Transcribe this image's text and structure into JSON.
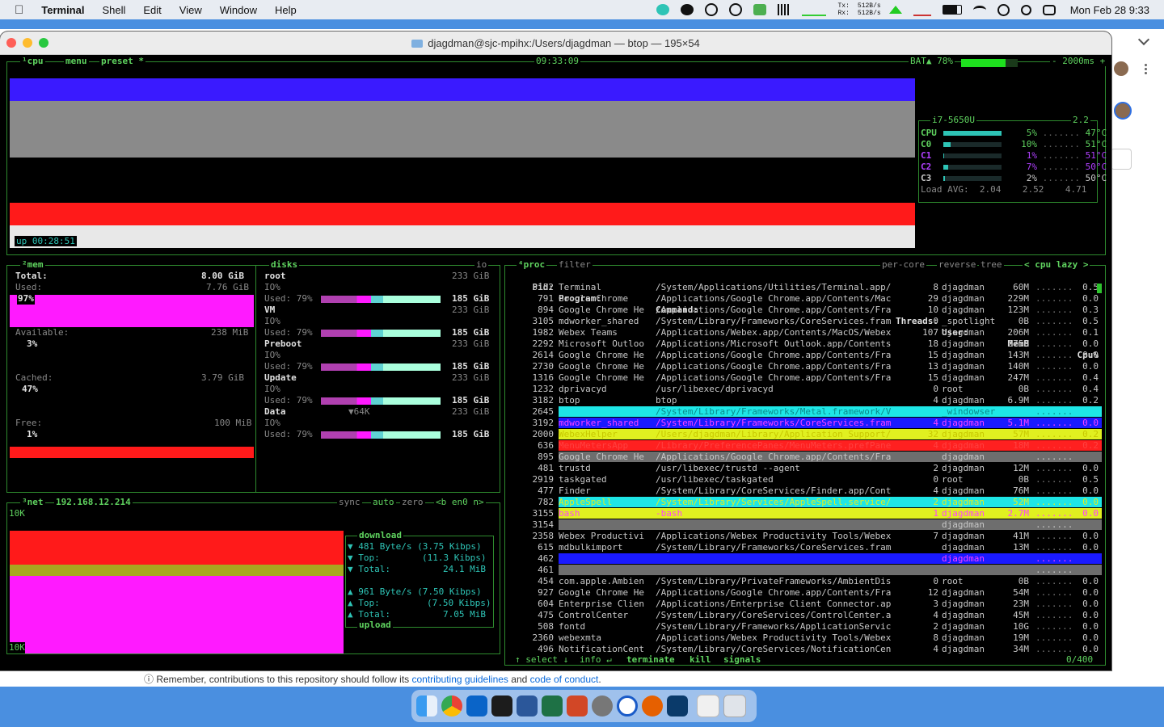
{
  "menubar": {
    "app": "Terminal",
    "items": [
      "Shell",
      "Edit",
      "View",
      "Window",
      "Help"
    ],
    "net_tx_label": "Tx:",
    "net_rx_label": "Rx:",
    "net_tx": "512B/s",
    "net_rx": "512B/s",
    "clock": "Mon Feb 28  9:33"
  },
  "window": {
    "title": "djagdman@sjc-mpihx:/Users/djagdman — btop — 195×54"
  },
  "cpu_box": {
    "tabs": [
      "¹cpu",
      "menu",
      "preset *"
    ],
    "time": "09:33:09",
    "battery": "BAT▲ 78%",
    "battery_level": 0.78,
    "interval": "- 2000ms +",
    "uptime_label": "up",
    "uptime": "00:28:51",
    "model": "i7-5650U",
    "freq": "2.2",
    "cores": [
      {
        "name": "CPU",
        "pct": "5%",
        "temp": "47°C",
        "color": "#5fd35f",
        "usage": 0.05
      },
      {
        "name": "C0",
        "pct": "10%",
        "temp": "51°C",
        "color": "#5fd35f",
        "usage": 0.1
      },
      {
        "name": "C1",
        "pct": "1%",
        "temp": "51°C",
        "color": "#b040ff",
        "usage": 0.01
      },
      {
        "name": "C2",
        "pct": "7%",
        "temp": "50°C",
        "color": "#b040ff",
        "usage": 0.07
      },
      {
        "name": "C3",
        "pct": "2%",
        "temp": "50°C",
        "color": "#c8c8c8",
        "usage": 0.02
      }
    ],
    "load_label": "Load AVG:",
    "load": [
      "2.04",
      "2.52",
      "4.71"
    ]
  },
  "mem_box": {
    "title": "²mem",
    "total_label": "Total:",
    "total": "8.00 GiB",
    "used_label": "Used:",
    "used": "7.76 GiB",
    "used_pct": "97%",
    "available_label": "Available:",
    "available": "238 MiB",
    "available_pct": "3%",
    "cached_label": "Cached:",
    "cached": "3.79 GiB",
    "cached_pct": "47%",
    "free_label": "Free:",
    "free": "100 MiB",
    "free_pct": "1%"
  },
  "disks_box": {
    "title": "disks",
    "io_label": "io",
    "disks": [
      {
        "name": "root",
        "size": "233 GiB",
        "io_label": "IO%",
        "used_label": "Used: 79%",
        "used": "185 GiB"
      },
      {
        "name": "VM",
        "size": "233 GiB",
        "io_label": "IO%",
        "used_label": "Used: 79%",
        "used": "185 GiB"
      },
      {
        "name": "Preboot",
        "size": "233 GiB",
        "io_label": "IO%",
        "used_label": "Used: 79%",
        "used": "185 GiB"
      },
      {
        "name": "Update",
        "size": "233 GiB",
        "io_label": "IO%",
        "used_label": "Used: 79%",
        "used": "185 GiB"
      },
      {
        "name": "Data",
        "size": "233 GiB",
        "extra": "▼64K",
        "io_label": "IO%",
        "used_label": "Used: 79%",
        "used": "185 GiB"
      }
    ]
  },
  "net_box": {
    "title": "³net",
    "ip": "192.168.12.214",
    "controls": [
      "sync",
      "auto",
      "zero",
      "<b en0 n>"
    ],
    "scale_top": "10K",
    "scale_bottom": "10K",
    "download_label": "download",
    "upload_label": "upload",
    "down_rate": "▼ 481 Byte/s (3.75 Kibps)",
    "down_top_label": "▼ Top:",
    "down_top": "(11.3 Kibps)",
    "down_total_label": "▼ Total:",
    "down_total": "24.1 MiB",
    "up_rate": "▲ 961 Byte/s (7.50 Kibps)",
    "up_top_label": "▲ Top:",
    "up_top": "(7.50 Kibps)",
    "up_total_label": "▲ Total:",
    "up_total": "7.05 MiB"
  },
  "proc_box": {
    "title": "⁴proc",
    "filter": "filter",
    "options": [
      "per-core",
      "reverse",
      "tree",
      "< cpu lazy >"
    ],
    "headers": {
      "pid": "Pid:",
      "program": "Program:",
      "command": "Command:",
      "threads": "Threads:",
      "user": "User:",
      "mem": "MemB",
      "cpu": "Cpu%"
    },
    "footer": [
      "↑ select ↓",
      "info ↵",
      "terminate",
      "kill",
      "signals"
    ],
    "count": "0/400",
    "rows": [
      {
        "pid": "3152",
        "program": "Terminal",
        "command": "/System/Applications/Utilities/Terminal.app/",
        "threads": "8",
        "user": "djagdman",
        "mem": "60M",
        "cpu": "0.5"
      },
      {
        "pid": "791",
        "program": "Google Chrome",
        "command": "/Applications/Google Chrome.app/Contents/Mac",
        "threads": "29",
        "user": "djagdman",
        "mem": "229M",
        "cpu": "0.0"
      },
      {
        "pid": "894",
        "program": "Google Chrome He",
        "command": "/Applications/Google Chrome.app/Contents/Fra",
        "threads": "10",
        "user": "djagdman",
        "mem": "123M",
        "cpu": "0.3"
      },
      {
        "pid": "3105",
        "program": "mdworker_shared",
        "command": "/System/Library/Frameworks/CoreServices.fram",
        "threads": "0",
        "user": "_spotlight",
        "mem": "0B",
        "cpu": "0.5"
      },
      {
        "pid": "1982",
        "program": "Webex Teams",
        "command": "/Applications/Webex.app/Contents/MacOS/Webex",
        "threads": "107",
        "user": "djagdman",
        "mem": "206M",
        "cpu": "0.1"
      },
      {
        "pid": "2292",
        "program": "Microsoft Outloo",
        "command": "/Applications/Microsoft Outlook.app/Contents",
        "threads": "18",
        "user": "djagdman",
        "mem": "275M",
        "cpu": "0.0"
      },
      {
        "pid": "2614",
        "program": "Google Chrome He",
        "command": "/Applications/Google Chrome.app/Contents/Fra",
        "threads": "15",
        "user": "djagdman",
        "mem": "143M",
        "cpu": "0.0"
      },
      {
        "pid": "2730",
        "program": "Google Chrome He",
        "command": "/Applications/Google Chrome.app/Contents/Fra",
        "threads": "13",
        "user": "djagdman",
        "mem": "140M",
        "cpu": "0.0"
      },
      {
        "pid": "1316",
        "program": "Google Chrome He",
        "command": "/Applications/Google Chrome.app/Contents/Fra",
        "threads": "15",
        "user": "djagdman",
        "mem": "247M",
        "cpu": "0.4"
      },
      {
        "pid": "1232",
        "program": "dprivacyd",
        "command": "/usr/libexec/dprivacyd",
        "threads": "0",
        "user": "root",
        "mem": "0B",
        "cpu": "0.4"
      },
      {
        "pid": "3182",
        "program": "btop",
        "command": "btop",
        "threads": "4",
        "user": "djagdman",
        "mem": "6.9M",
        "cpu": "0.2"
      },
      {
        "pid": "2645",
        "program": "",
        "command": "/System/Library/Frameworks/Metal.framework/V",
        "threads": "",
        "user": "_windowser",
        "mem": "",
        "cpu": "",
        "bg": "#1ee6e6",
        "fg": "#0a8a8a"
      },
      {
        "pid": "3192",
        "program": "mdworker_shared",
        "command": "/System/Library/Frameworks/CoreServices.fram",
        "threads": "4",
        "user": "djagdman",
        "mem": "5.1M",
        "cpu": "0.0",
        "bg": "#1a1aff",
        "fg": "#ff40ff"
      },
      {
        "pid": "2000",
        "program": "WebexHelper",
        "command": "/Users/djagdman/Library/Application Support/",
        "threads": "32",
        "user": "djagdman",
        "mem": "57M",
        "cpu": "0.2",
        "bg": "#e0f020",
        "fg": "#c8c800"
      },
      {
        "pid": "636",
        "program": "MenuMetersApp",
        "command": "/Library/PreferencePanes/MenuMeters.prefPane",
        "threads": "4",
        "user": "djagdman",
        "mem": "18M",
        "cpu": "0.2",
        "bg": "#ff2020",
        "fg": "#ff4040"
      },
      {
        "pid": "895",
        "program": "Google Chrome He",
        "command": "/Applications/Google Chrome.app/Contents/Fra",
        "threads": "",
        "user": "djagdman",
        "mem": "",
        "cpu": "",
        "bg": "#6e6e6e",
        "fg": "#c8c8c8"
      },
      {
        "pid": "481",
        "program": "trustd",
        "command": "/usr/libexec/trustd --agent",
        "threads": "2",
        "user": "djagdman",
        "mem": "12M",
        "cpu": "0.0"
      },
      {
        "pid": "2919",
        "program": "taskgated",
        "command": "/usr/libexec/taskgated",
        "threads": "0",
        "user": "root",
        "mem": "0B",
        "cpu": "0.5"
      },
      {
        "pid": "477",
        "program": "Finder",
        "command": "/System/Library/CoreServices/Finder.app/Cont",
        "threads": "4",
        "user": "djagdman",
        "mem": "76M",
        "cpu": "0.0"
      },
      {
        "pid": "782",
        "program": "AppleSpell",
        "command": "/System/Library/Services/AppleSpell.service/",
        "threads": "2",
        "user": "djagdman",
        "mem": "52M",
        "cpu": "0.0",
        "bg": "#1ee6e6",
        "fg": "#e0f020"
      },
      {
        "pid": "3155",
        "program": "bash",
        "command": "-bash",
        "threads": "1",
        "user": "djagdman",
        "mem": "2.7M",
        "cpu": "0.0",
        "bg": "#e0f020",
        "fg": "#ff40ff"
      },
      {
        "pid": "3154",
        "program": "",
        "command": "",
        "threads": "",
        "user": "djagdman",
        "mem": "",
        "cpu": "",
        "bg": "#6e6e6e",
        "fg": "#c8c8c8"
      },
      {
        "pid": "2358",
        "program": "Webex Productivi",
        "command": "/Applications/Webex Productivity Tools/Webex",
        "threads": "7",
        "user": "djagdman",
        "mem": "41M",
        "cpu": "0.0"
      },
      {
        "pid": "615",
        "program": "mdbulkimport",
        "command": "/System/Library/Frameworks/CoreServices.fram",
        "threads": "",
        "user": "djagdman",
        "mem": "13M",
        "cpu": "0.0"
      },
      {
        "pid": "462",
        "program": "",
        "command": "",
        "threads": "",
        "user": "djagdman",
        "mem": "",
        "cpu": "",
        "bg": "#1a1aff",
        "fg": "#ff40ff"
      },
      {
        "pid": "461",
        "program": "",
        "command": "",
        "threads": "",
        "user": "",
        "mem": "",
        "cpu": "",
        "bg": "#6e6e6e",
        "fg": "#c8c8c8"
      },
      {
        "pid": "454",
        "program": "com.apple.Ambien",
        "command": "/System/Library/PrivateFrameworks/AmbientDis",
        "threads": "0",
        "user": "root",
        "mem": "0B",
        "cpu": "0.0"
      },
      {
        "pid": "927",
        "program": "Google Chrome He",
        "command": "/Applications/Google Chrome.app/Contents/Fra",
        "threads": "12",
        "user": "djagdman",
        "mem": "54M",
        "cpu": "0.0"
      },
      {
        "pid": "604",
        "program": "Enterprise Clien",
        "command": "/Applications/Enterprise Client Connector.ap",
        "threads": "3",
        "user": "djagdman",
        "mem": "23M",
        "cpu": "0.0"
      },
      {
        "pid": "475",
        "program": "ControlCenter",
        "command": "/System/Library/CoreServices/ControlCenter.a",
        "threads": "4",
        "user": "djagdman",
        "mem": "45M",
        "cpu": "0.0"
      },
      {
        "pid": "508",
        "program": "fontd",
        "command": "/System/Library/Frameworks/ApplicationServic",
        "threads": "2",
        "user": "djagdman",
        "mem": "10G",
        "cpu": "0.0"
      },
      {
        "pid": "2360",
        "program": "webexmta",
        "command": "/Applications/Webex Productivity Tools/Webex",
        "threads": "8",
        "user": "djagdman",
        "mem": "19M",
        "cpu": "0.0"
      },
      {
        "pid": "496",
        "program": "NotificationCent",
        "command": "/System/Library/CoreServices/NotificationCen",
        "threads": "4",
        "user": "djagdman",
        "mem": "34M",
        "cpu": "0.0"
      }
    ]
  },
  "background": {
    "note_prefix": "Remember, contributions to this repository should follow its",
    "link1": "contributing guidelines",
    "and": "and",
    "link2": "code of conduct",
    "suffix": "."
  },
  "colors": {
    "frame": "#2e8b2e",
    "accent": "#5fd35f",
    "magenta": "#ff1aff",
    "red": "#ff1a1a",
    "blue": "#3a1aff"
  }
}
